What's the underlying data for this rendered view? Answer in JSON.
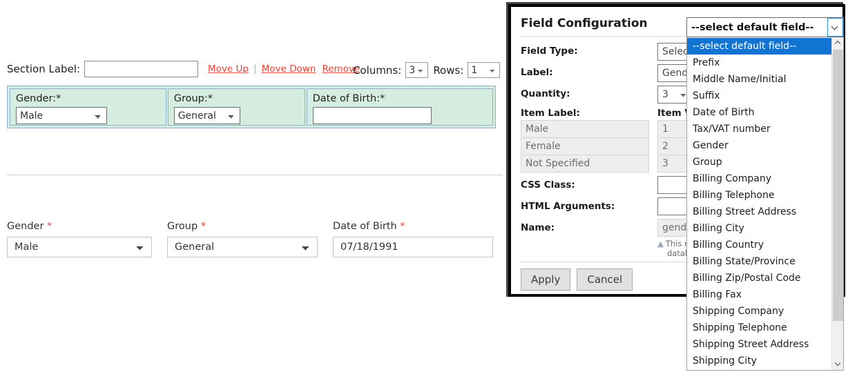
{
  "section_editor": {
    "section_label_text": "Section Label:",
    "section_label_value": "",
    "section_label_placeholder": "",
    "links": {
      "move_up": "Move Up",
      "separator": "|",
      "move_down": "Move Down",
      "remove": "Remove"
    },
    "columns_label": "Columns:",
    "columns_value": "3",
    "rows_label": "Rows:",
    "rows_value": "1",
    "fields": [
      {
        "label": "Gender:*",
        "control": "select",
        "value": "Male"
      },
      {
        "label": "Group:*",
        "control": "select",
        "value": "General"
      },
      {
        "label": "Date of Birth:*",
        "control": "input",
        "value": ""
      }
    ]
  },
  "form_preview": {
    "fields": [
      {
        "label": "Gender",
        "required_mark": "*",
        "control": "select",
        "value": "Male"
      },
      {
        "label": "Group",
        "required_mark": "*",
        "control": "select",
        "value": "General"
      },
      {
        "label": "Date of Birth",
        "required_mark": "*",
        "control": "input",
        "value": "07/18/1991"
      }
    ]
  },
  "dialog": {
    "title": "Field Configuration",
    "rows": {
      "field_type_label": "Field Type:",
      "field_type_value": "Select",
      "label_label": "Label:",
      "label_value": "Gende",
      "quantity_label": "Quantity:",
      "quantity_value": "3",
      "item_label_header": "Item Label:",
      "item_value_header": "Item Va",
      "css_class_label": "CSS Class:",
      "css_class_value": "",
      "html_arguments_label": "HTML Arguments:",
      "html_arguments_value": "",
      "name_label": "Name:",
      "name_value": "gender"
    },
    "items": [
      {
        "label": "Male",
        "value": "1"
      },
      {
        "label": "Female",
        "value": "2"
      },
      {
        "label": "Not Specified",
        "value": "3"
      }
    ],
    "note_icon": "▲",
    "note_line1": "This na",
    "note_line2": "databa",
    "buttons": {
      "apply": "Apply",
      "cancel": "Cancel"
    }
  },
  "default_field_combo": {
    "selected_value": "--select default field--",
    "chevron_icon": "chevron-down-icon",
    "scroll_up_icon": "scroll-up-arrow-icon",
    "scroll_down_icon": "scroll-down-arrow-icon",
    "options": [
      "--select default field--",
      "Prefix",
      "Middle Name/Initial",
      "Suffix",
      "Date of Birth",
      "Tax/VAT number",
      "Gender",
      "Group",
      "Billing Company",
      "Billing Telephone",
      "Billing Street Address",
      "Billing City",
      "Billing Country",
      "Billing State/Province",
      "Billing Zip/Postal Code",
      "Billing Fax",
      "Shipping Company",
      "Shipping Telephone",
      "Shipping Street Address",
      "Shipping City"
    ],
    "selected_index": 0
  },
  "colors": {
    "link": "#ef3f33",
    "section_bg": "#d5ece0",
    "section_border": "#8fb3cc",
    "highlight": "#1174d3",
    "required": "#e8453c"
  }
}
